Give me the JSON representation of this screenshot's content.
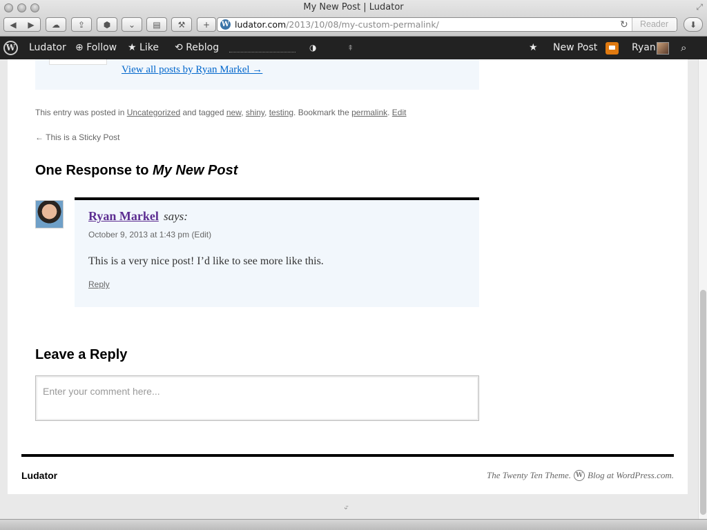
{
  "window": {
    "title": "My New Post | Ludator"
  },
  "toolbar": {
    "back_icon": "◀",
    "forward_icon": "▶",
    "new_tab_icon": "+",
    "url_domain": "ludator.com",
    "url_path": "/2013/10/08/my-custom-permalink/",
    "reader_label": "Reader"
  },
  "adminbar": {
    "site": "Ludator",
    "follow": "Follow",
    "like": "Like",
    "reblog": "Reblog",
    "new_post": "New Post",
    "user": "Ryan"
  },
  "post": {
    "author_link": "View all posts by Ryan Markel →",
    "meta": {
      "prefix": "This entry was posted in ",
      "category": "Uncategorized",
      "tagged": " and tagged ",
      "tags": [
        "new",
        "shiny",
        "testing"
      ],
      "bookmark": ". Bookmark the ",
      "permalink": "permalink",
      "edit": "Edit"
    },
    "prev_post": "← This is a Sticky Post"
  },
  "comments": {
    "title_prefix": "One Response to ",
    "title_post": "My New Post",
    "items": [
      {
        "author": "Ryan Markel",
        "says": "says:",
        "date": "October 9, 2013 at 1:43 pm",
        "edit": "(Edit)",
        "text": "This is a very nice post! I’d like to see more like this.",
        "reply": "Reply"
      }
    ]
  },
  "reply_form": {
    "title": "Leave a Reply",
    "placeholder": "Enter your comment here..."
  },
  "footer": {
    "site": "Ludator",
    "theme": "The Twenty Ten Theme.",
    "blog_at": "Blog at WordPress.com."
  },
  "colors": {
    "link": "#0066cc",
    "visited": "#5c2d91",
    "adminbar": "#222222",
    "notification": "#e07a10"
  }
}
